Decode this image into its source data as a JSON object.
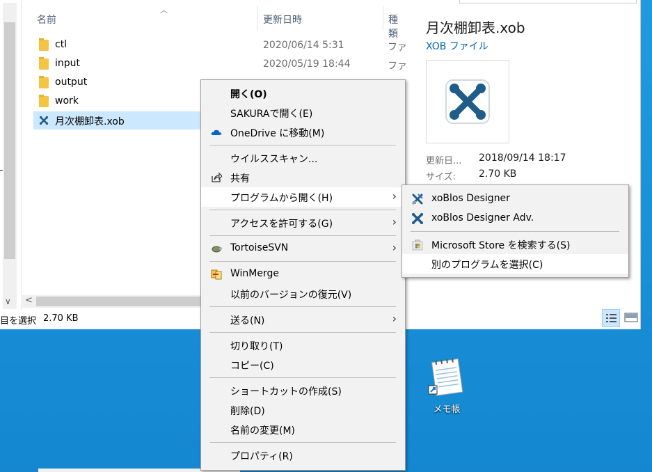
{
  "explorer": {
    "columns": {
      "name": "名前",
      "date": "更新日時",
      "type": "種類"
    },
    "files": [
      {
        "name": "ctl",
        "date": "2020/06/14 5:31",
        "type": "ファ",
        "kind": "folder"
      },
      {
        "name": "input",
        "date": "2020/05/19 18:44",
        "type": "ファ",
        "kind": "folder"
      },
      {
        "name": "output",
        "date": "",
        "type": "",
        "kind": "folder"
      },
      {
        "name": "work",
        "date": "",
        "type": "",
        "kind": "folder"
      },
      {
        "name": "月次棚卸表.xob",
        "date": "",
        "type": "",
        "kind": "xob",
        "selected": true
      }
    ],
    "status": {
      "selected_text": "目を選択",
      "size": "2.70 KB"
    }
  },
  "preview": {
    "title": "月次棚卸表.xob",
    "subtitle": "XOB ファイル",
    "modified_label": "更新日...",
    "modified_value": "2018/09/14 18:17",
    "size_label": "サイズ:",
    "size_value": "2.70 KB"
  },
  "context_menu": {
    "items": [
      {
        "label": "開く(O)",
        "bold": true
      },
      {
        "label": "SAKURAで開く(E)"
      },
      {
        "label": "OneDrive に移動(M)",
        "icon": "onedrive-icon"
      },
      {
        "label": "ウイルススキャン..."
      },
      {
        "label": "共有",
        "icon": "share-icon"
      },
      {
        "label": "プログラムから開く(H)",
        "submenu": true
      },
      {
        "label": "アクセスを許可する(G)",
        "submenu": true
      },
      {
        "label": "TortoiseSVN",
        "icon": "tortoisesvn-icon",
        "submenu": true
      },
      {
        "label": "WinMerge",
        "icon": "winmerge-icon"
      },
      {
        "label": "以前のバージョンの復元(V)"
      },
      {
        "label": "送る(N)",
        "submenu": true
      },
      {
        "label": "切り取り(T)"
      },
      {
        "label": "コピー(C)"
      },
      {
        "label": "ショートカットの作成(S)"
      },
      {
        "label": "削除(D)"
      },
      {
        "label": "名前の変更(M)"
      },
      {
        "label": "プロパティ(R)"
      }
    ]
  },
  "open_with_submenu": {
    "items": [
      {
        "label": "xoBlos Designer",
        "icon": "xoblos-designer-icon"
      },
      {
        "label": "xoBlos Designer Adv.",
        "icon": "xoblos-adv-icon"
      },
      {
        "label": "Microsoft Store を検索する(S)",
        "icon": "store-icon"
      },
      {
        "label": "別のプログラムを選択(C)"
      }
    ]
  },
  "desktop": {
    "icons": [
      {
        "label": "メモ帳",
        "icon": "notepad-icon"
      }
    ]
  },
  "colors": {
    "selection": "#cce8ff",
    "desktop": "#1a8fd6",
    "link": "#0064b4",
    "xob_brand": "#1f5c8a"
  }
}
